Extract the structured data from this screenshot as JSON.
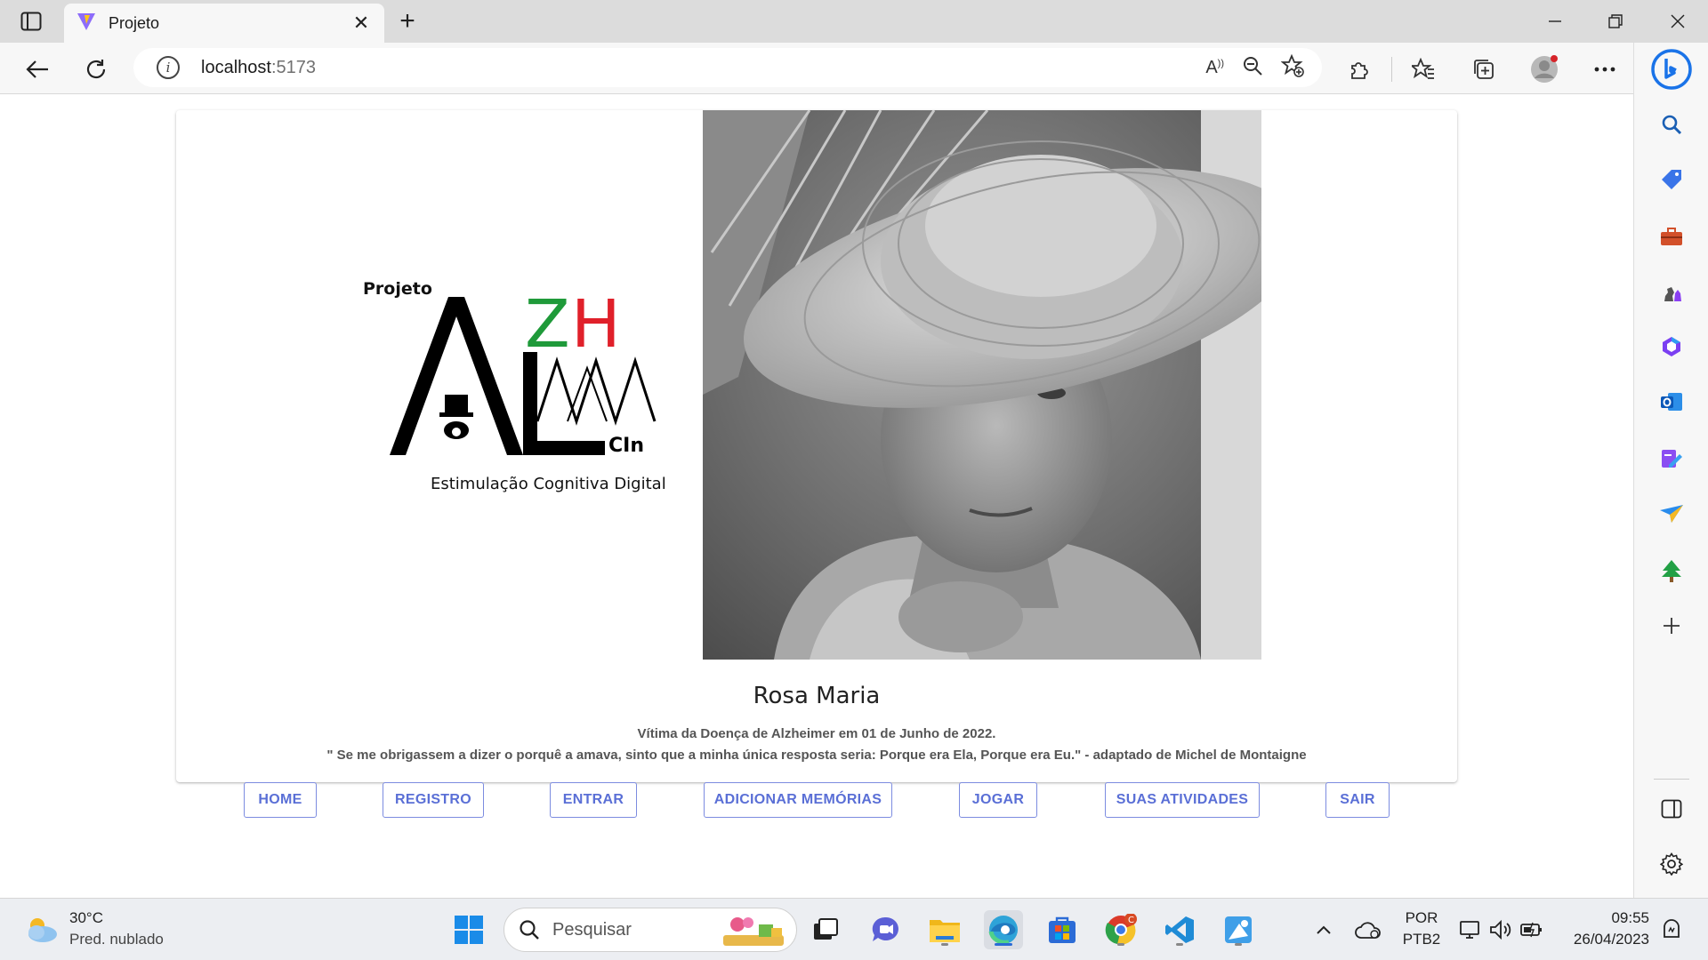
{
  "browser": {
    "tab_title": "Projeto",
    "address_host": "localhost",
    "address_port": ":5173"
  },
  "page": {
    "logo": {
      "projeto": "Projeto",
      "letters_black": "AL",
      "letters_red": "H",
      "letters_green": "Z",
      "cin": "CIn",
      "subtitle": "Estimulação Cognitiva Digital"
    },
    "photo_alt": "Rosa Maria",
    "name": "Rosa Maria",
    "line1": "Vítima da Doença de Alzheimer em 01 de Junho de 2022.",
    "line2": "\" Se me obrigassem a dizer o porquê a amava, sinto que a minha única resposta seria: Porque era Ela, Porque era Eu.\" - adaptado de Michel de Montaigne",
    "nav": [
      "HOME",
      "REGISTRO",
      "ENTRAR",
      "ADICIONAR MEMÓRIAS",
      "JOGAR",
      "SUAS ATIVIDADES",
      "SAIR"
    ]
  },
  "taskbar": {
    "weather_temp": "30°C",
    "weather_desc": "Pred. nublado",
    "search_placeholder": "Pesquisar",
    "lang_1": "POR",
    "lang_2": "PTB2",
    "time": "09:55",
    "date": "26/04/2023",
    "chrome_badge": "C"
  },
  "colors": {
    "accent": "#5a6fd6",
    "logo_red": "#e0202a",
    "logo_green": "#1f9a3a",
    "tab_strip": "#dcdcdc"
  }
}
